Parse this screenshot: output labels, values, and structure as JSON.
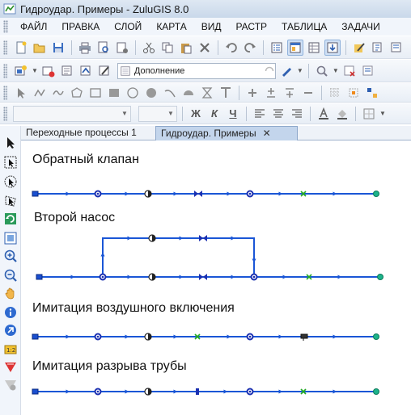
{
  "window": {
    "title": "Гидроудар. Примеры - ZuluGIS 8.0"
  },
  "menu": [
    "ФАЙЛ",
    "ПРАВКА",
    "СЛОЙ",
    "КАРТА",
    "ВИД",
    "РАСТР",
    "ТАБЛИЦА",
    "ЗАДАЧИ"
  ],
  "toolbar2": {
    "layer_combo_value": "Дополнение"
  },
  "tabs": [
    {
      "label": "Переходные процессы 1",
      "active": false
    },
    {
      "label": "Гидроудар. Примеры",
      "active": true,
      "close_glyph": "✕"
    }
  ],
  "format_buttons": {
    "bold": "Ж",
    "italic": "К",
    "underline": "Ч"
  },
  "schemes": [
    {
      "title": "Обратный клапан"
    },
    {
      "title": "Второй насос"
    },
    {
      "title": "Имитация воздушного включения"
    },
    {
      "title": "Имитация разрыва трубы"
    }
  ],
  "colors": {
    "pipe": "#1a56d6",
    "node_end": "#1db38a",
    "valve": "#22aa22",
    "pump_body": "#1a2fb0",
    "accent": "#c3d5ec"
  }
}
